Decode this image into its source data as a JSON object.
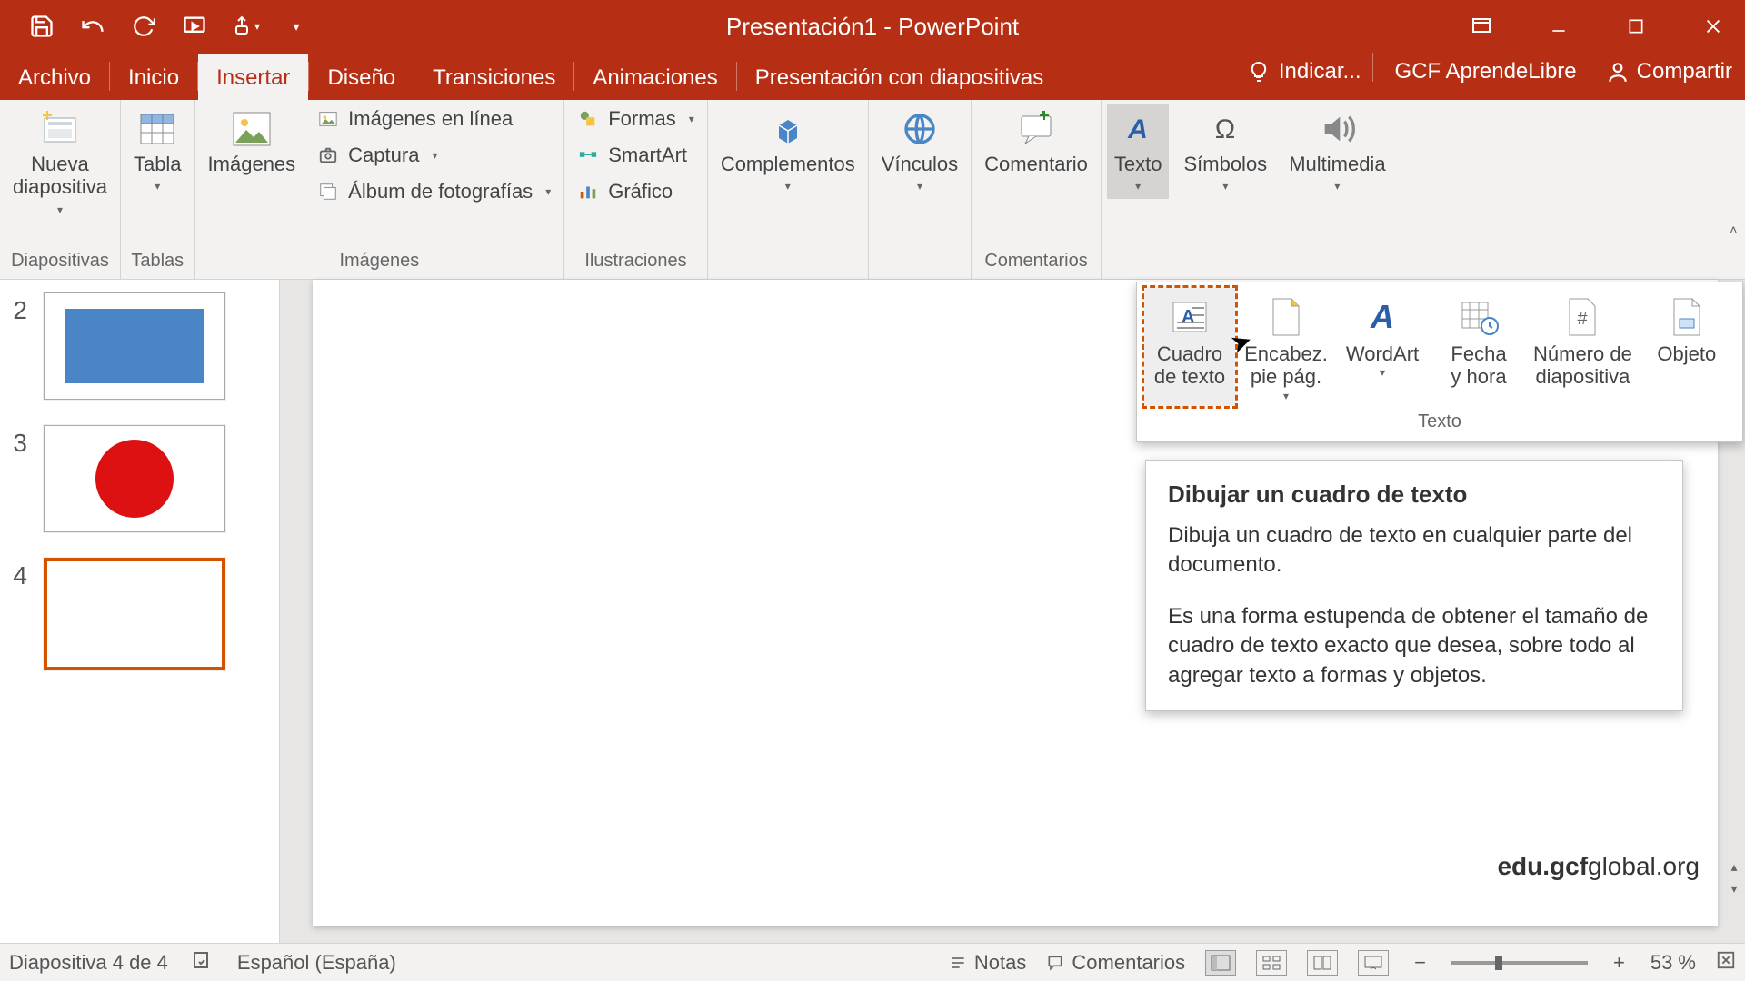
{
  "title": "Presentación1 - PowerPoint",
  "tabs": {
    "archivo": "Archivo",
    "inicio": "Inicio",
    "insertar": "Insertar",
    "diseno": "Diseño",
    "transiciones": "Transiciones",
    "animaciones": "Animaciones",
    "presentacion": "Presentación con diapositivas",
    "indicar": "Indicar...",
    "gcf": "GCF AprendeLibre",
    "compartir": "Compartir"
  },
  "ribbon": {
    "nueva_diapositiva": "Nueva\ndiapositiva",
    "diapositivas": "Diapositivas",
    "tabla": "Tabla",
    "tablas": "Tablas",
    "imagenes": "Imágenes",
    "imagenes_en_linea": "Imágenes en línea",
    "captura": "Captura",
    "album": "Álbum de fotografías",
    "grupo_imagenes": "Imágenes",
    "formas": "Formas",
    "smartart": "SmartArt",
    "grafico": "Gráfico",
    "ilustraciones": "Ilustraciones",
    "complementos": "Complementos",
    "vinculos": "Vínculos",
    "comentario": "Comentario",
    "comentarios": "Comentarios",
    "texto": "Texto",
    "simbolos": "Símbolos",
    "multimedia": "Multimedia"
  },
  "gallery": {
    "cuadro": "Cuadro\nde texto",
    "encabez": "Encabez.\npie pág.",
    "wordart": "WordArt",
    "fecha": "Fecha\ny hora",
    "numero": "Número de\ndiapositiva",
    "objeto": "Objeto",
    "label": "Texto"
  },
  "tooltip": {
    "title": "Dibujar un cuadro de texto",
    "p1": "Dibuja un cuadro de texto en cualquier parte del documento.",
    "p2": "Es una forma estupenda de obtener el tamaño de cuadro de texto exacto que desea, sobre todo al agregar texto a formas y objetos."
  },
  "thumbs": {
    "n2": "2",
    "n3": "3",
    "n4": "4"
  },
  "watermark": "edu.gcfglobal.org",
  "status": {
    "slide": "Diapositiva 4 de 4",
    "lang": "Español (España)",
    "notas": "Notas",
    "comentarios": "Comentarios",
    "zoom": "53 %"
  }
}
